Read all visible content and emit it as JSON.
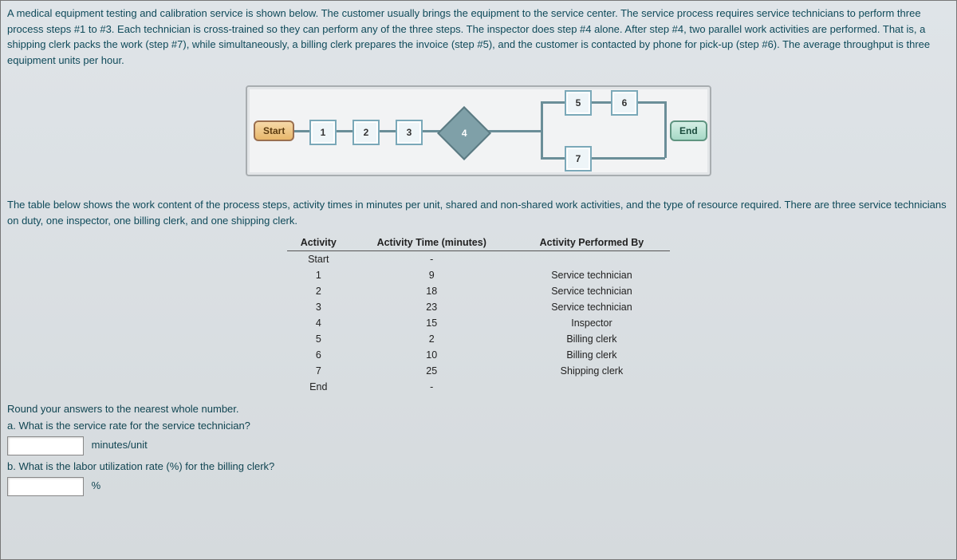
{
  "description": {
    "p1": "A medical equipment testing and calibration service is shown below. The customer usually brings the equipment to the service center. The service process requires service technicians to perform three process steps #1 to #3. Each technician is cross-trained so they can perform any of the three steps. The inspector does step #4 alone. After step #4, two parallel work activities are performed. That is, a shipping clerk packs the work (step #7), while simultaneously, a billing clerk prepares the invoice (step #5), and the customer is contacted by phone for pick-up (step #6). The average throughput is three equipment units per hour.",
    "p2": "The table below shows the work content of the process steps, activity times in minutes per unit, shared and non-shared work activities, and the type of resource required. There are three service technicians on duty, one inspector, one billing clerk, and one shipping clerk."
  },
  "diagram": {
    "start": "Start",
    "n1": "1",
    "n2": "2",
    "n3": "3",
    "n4": "4",
    "n5": "5",
    "n6": "6",
    "n7": "7",
    "end": "End"
  },
  "table": {
    "headers": {
      "activity": "Activity",
      "time": "Activity Time (minutes)",
      "by": "Activity Performed By"
    },
    "rows": [
      {
        "activity": "Start",
        "time": "-",
        "by": ""
      },
      {
        "activity": "1",
        "time": "9",
        "by": "Service technician"
      },
      {
        "activity": "2",
        "time": "18",
        "by": "Service technician"
      },
      {
        "activity": "3",
        "time": "23",
        "by": "Service technician"
      },
      {
        "activity": "4",
        "time": "15",
        "by": "Inspector"
      },
      {
        "activity": "5",
        "time": "2",
        "by": "Billing clerk"
      },
      {
        "activity": "6",
        "time": "10",
        "by": "Billing clerk"
      },
      {
        "activity": "7",
        "time": "25",
        "by": "Shipping clerk"
      },
      {
        "activity": "End",
        "time": "-",
        "by": ""
      }
    ]
  },
  "questions": {
    "round": "Round your answers to the nearest whole number.",
    "a": "a. What is the service rate for the service technician?",
    "a_unit": "minutes/unit",
    "b": "b. What is the labor utilization rate (%) for the billing clerk?",
    "b_unit": "%"
  }
}
